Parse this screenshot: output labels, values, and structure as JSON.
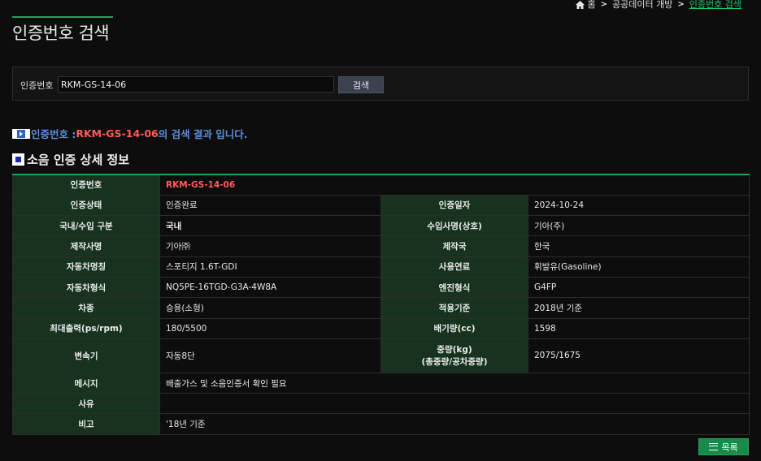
{
  "breadcrumb": {
    "home": "홈",
    "level1": "공공데이터 개방",
    "current": "인증번호 검색"
  },
  "page_title": "인증번호 검색",
  "search": {
    "label": "인증번호",
    "value": "RKM-GS-14-06",
    "button": "검색"
  },
  "result_message": {
    "prefix": "인증번호 : ",
    "number": "RKM-GS-14-06",
    "suffix": " 의 검색 결과 입니다."
  },
  "section_title": "소음 인증 상세 정보",
  "details": {
    "cert_no_label": "인증번호",
    "cert_no": "RKM-GS-14-06",
    "status_label": "인증상태",
    "status": "인증완료",
    "date_label": "인증일자",
    "date": "2024-10-24",
    "origin_label": "국내/수입 구분",
    "origin": "국내",
    "importer_label": "수입사명(상호)",
    "importer": "기아(주)",
    "maker_label": "제작사명",
    "maker": "기아㈜",
    "country_label": "제작국",
    "country": "한국",
    "car_name_label": "자동차명칭",
    "car_name": "스포티지 1.6T-GDI",
    "fuel_label": "사용연료",
    "fuel": "휘발유(Gasoline)",
    "car_type_label": "자동차형식",
    "car_type": "NQ5PE-16TGD-G3A-4W8A",
    "engine_label": "엔진형식",
    "engine": "G4FP",
    "class_label": "차종",
    "class": "승용(소형)",
    "standard_label": "적용기준",
    "standard": "2018년 기준",
    "power_label": "최대출력(ps/rpm)",
    "power": "180/5500",
    "displacement_label": "배기량(cc)",
    "displacement": "1598",
    "transmission_label": "변속기",
    "transmission": "자동8단",
    "weight_label_1": "중량(kg)",
    "weight_label_2": "(총중량/공차중량)",
    "weight": "2075/1675",
    "message_label": "메시지",
    "message": "배출가스 및 소음인증서 확인 필요",
    "reason_label": "사유",
    "reason": "",
    "remark_label": "비고",
    "remark": "'18년 기준"
  },
  "list_button": "목록",
  "colors": {
    "accent_green": "#1fa55b",
    "header_cell": "#17331f",
    "highlight_red": "#ff5b5b",
    "message_blue": "#5b8fd8"
  }
}
